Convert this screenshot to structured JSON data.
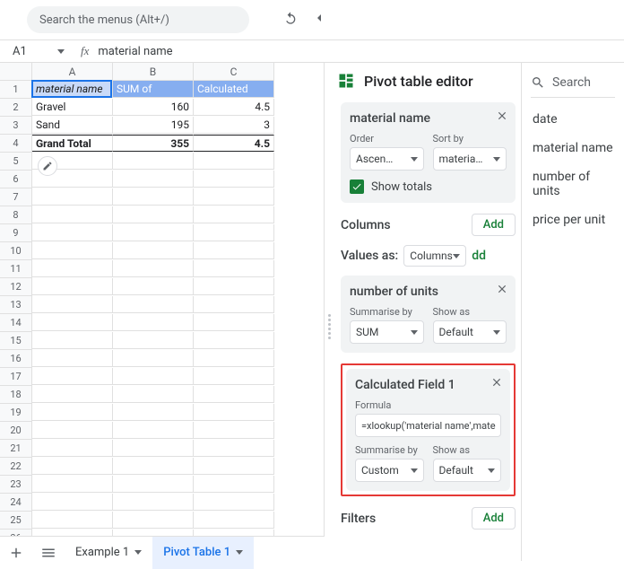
{
  "top": {
    "search_placeholder": "Search the menus (Alt+/)"
  },
  "cell_ref": "A1",
  "fx": {
    "label": "fx",
    "value": "material name"
  },
  "grid": {
    "cols": [
      "A",
      "B",
      "C"
    ],
    "rows": 26,
    "data": [
      [
        "material name",
        "SUM of number",
        "Calculated Field"
      ],
      [
        "Gravel",
        "160",
        "4.5"
      ],
      [
        "Sand",
        "195",
        "3"
      ],
      [
        "Grand Total",
        "355",
        "4.5"
      ]
    ]
  },
  "editor": {
    "title": "Pivot table editor",
    "rows_panel": {
      "title": "material name",
      "order_label": "Order",
      "order_value": "Ascen…",
      "sort_label": "Sort by",
      "sort_value": "materia…",
      "show_totals": "Show totals"
    },
    "columns_label": "Columns",
    "values_label": "Values as:",
    "values_value": "Columns",
    "add_label": "Add",
    "dd_label": "dd",
    "units_panel": {
      "title": "number of units",
      "summarise_label": "Summarise by",
      "summarise_value": "SUM",
      "show_label": "Show as",
      "show_value": "Default"
    },
    "calc_panel": {
      "title": "Calculated Field 1",
      "formula_label": "Formula",
      "formula_value": "=xlookup('material name',mate",
      "summarise_label": "Summarise by",
      "summarise_value": "Custom",
      "show_label": "Show as",
      "show_value": "Default"
    },
    "filters_label": "Filters"
  },
  "fields": {
    "search_placeholder": "Search",
    "items": [
      "date",
      "material name",
      "number of units",
      "price per unit"
    ]
  },
  "sheets": {
    "tabs": [
      "Example 1",
      "Pivot Table 1"
    ],
    "active": 1
  }
}
